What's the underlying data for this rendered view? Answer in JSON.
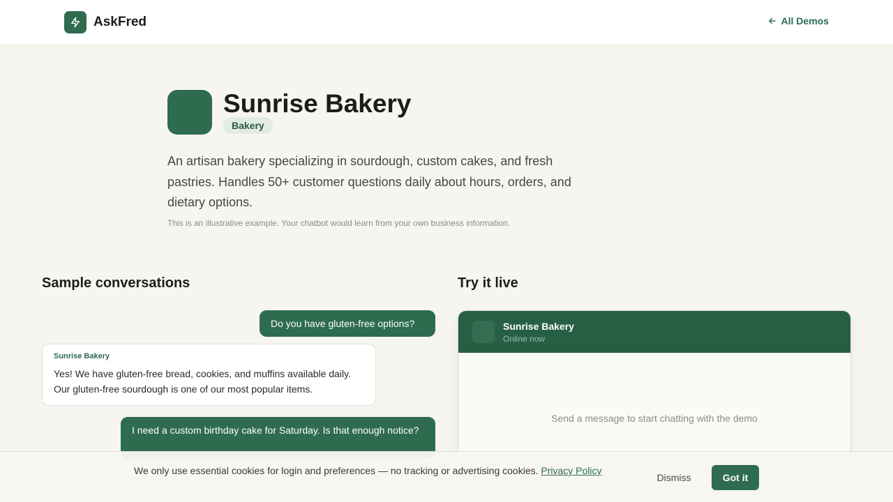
{
  "header": {
    "brand_name": "AskFred",
    "all_demos_label": "All Demos"
  },
  "hero": {
    "title": "Sunrise Bakery",
    "badge": "Bakery",
    "description": "An artisan bakery specializing in sourdough, custom cakes, and fresh pastries. Handles 50+ customer questions daily about hours, orders, and dietary options.",
    "note": "This is an illustrative example. Your chatbot would learn from your own business information."
  },
  "samples": {
    "heading": "Sample conversations",
    "messages": [
      {
        "role": "user",
        "text": "Do you have gluten-free options?"
      },
      {
        "role": "bot",
        "sender": "Sunrise Bakery",
        "text": "Yes! We have gluten-free bread, cookies, and muffins available daily. Our gluten-free sourdough is one of our most popular items."
      },
      {
        "role": "user",
        "text": "I need a custom birthday cake for Saturday. Is that enough notice?"
      }
    ]
  },
  "live": {
    "heading": "Try it live",
    "chat_title": "Sunrise Bakery",
    "chat_status": "Online now",
    "empty_message": "Send a message to start chatting with the demo"
  },
  "cookie": {
    "text": "We only use essential cookies for login and preferences — no tracking or advertising cookies.",
    "link_label": "Privacy Policy",
    "dismiss_label": "Dismiss",
    "accept_label": "Got it"
  },
  "colors": {
    "brand_green": "#2e6b4f",
    "chat_header": "#275f45",
    "background": "#f6f5f0"
  },
  "icons": {
    "brand_logo": "lightning-bolt-icon",
    "back": "arrow-left-icon"
  }
}
